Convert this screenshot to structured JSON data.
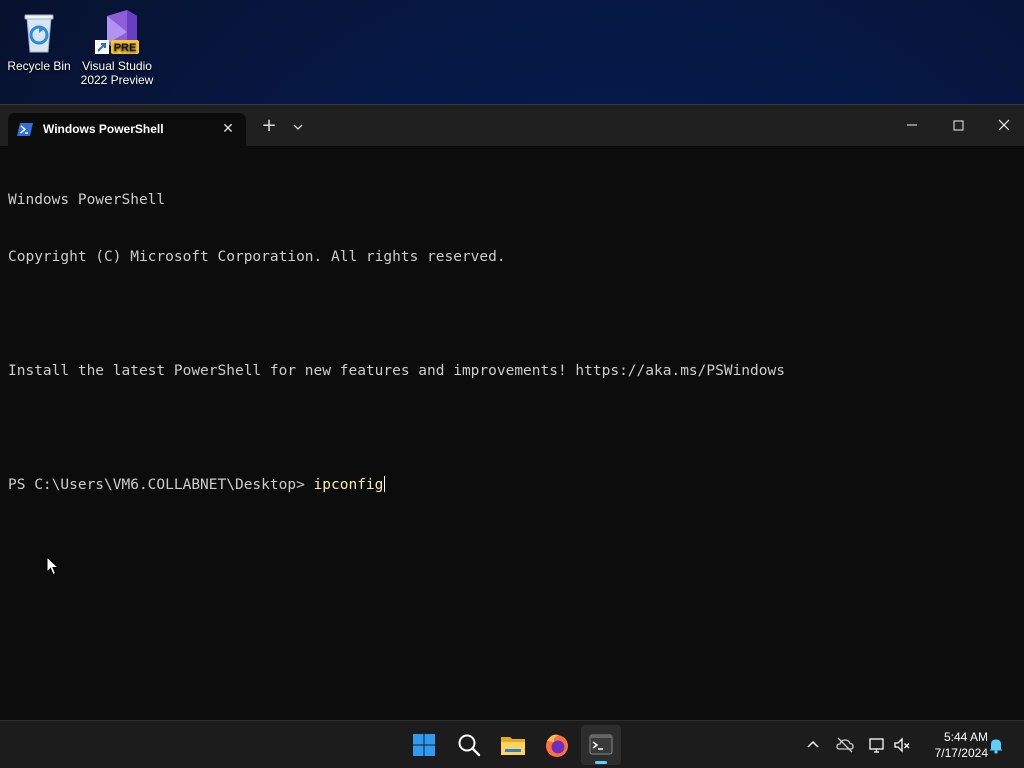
{
  "desktop": {
    "icons": [
      {
        "label_line1": "Recycle Bin",
        "label_line2": ""
      },
      {
        "label_line1": "Visual Studio",
        "label_line2": "2022 Preview",
        "badge": "PRE"
      }
    ]
  },
  "window": {
    "tab_title": "Windows PowerShell",
    "new_tab_symbol": "+",
    "close_tab_symbol": "✕"
  },
  "terminal": {
    "lines": [
      "Windows PowerShell",
      "Copyright (C) Microsoft Corporation. All rights reserved.",
      "",
      "Install the latest PowerShell for new features and improvements! https://aka.ms/PSWindows",
      ""
    ],
    "prompt": "PS C:\\Users\\VM6.COLLABNET\\Desktop> ",
    "command": "ipconfig"
  },
  "taskbar": {
    "apps": [
      "start-icon",
      "search-icon",
      "file-explorer-icon",
      "firefox-icon",
      "terminal-icon"
    ],
    "time": "5:44 AM",
    "date": "7/17/2024"
  },
  "colors": {
    "terminal_bg": "#0c0c0c",
    "terminal_text": "#cccccc",
    "command_text": "#f9f1a5",
    "titlebar_bg": "#202020",
    "taskbar_bg": "#1c1c1c",
    "accent": "#60cdff"
  }
}
